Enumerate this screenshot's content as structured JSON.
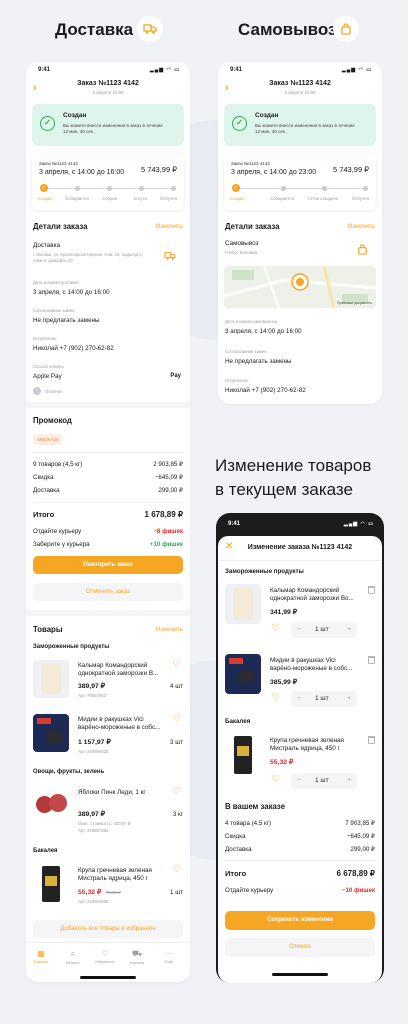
{
  "titles": {
    "delivery": "Доставка",
    "pickup": "Самовывоз",
    "edit_title": "Изменение товаров",
    "edit_title2": "в текущем заказе"
  },
  "colors": {
    "accent": "#f5a623",
    "green": "#2dae5a",
    "red": "#e02a2a",
    "status_bg": "#dff4ea"
  },
  "status_bar": {
    "time": "9:41"
  },
  "order_header": {
    "title": "Заказ №1123 4142",
    "date": "2 апреля 10:56"
  },
  "status": {
    "title": "Создан",
    "text": "Вы можете внести изменения в заказ в течение 13 мин. 30 сек."
  },
  "delivery": {
    "card": {
      "order": "Заказ №1123 4142",
      "when": "3 апреля, с 14:00 до 16:00",
      "sum": "5 743,99 ₽",
      "steps": [
        "Создан",
        "Собирается",
        "Собран",
        "В пути",
        "Получен"
      ]
    },
    "details": {
      "title": "Детали заказа",
      "edit": "Изменить",
      "type": "Доставка",
      "address": "г. Москва, ул. Краснопролетарская, 9 кв. 23, подъезд 2, этаж 3, домофон 23",
      "time_label": "Дата и время доставки",
      "time": "3 апреля, с 14:00 до 16:00",
      "repl_label": "Согласование замен",
      "repl": "Не предлагать замены",
      "recv_label": "Получатель",
      "recv": "Николай +7 (902) 270-62-82",
      "pay_label": "Способ оплаты",
      "pay": "Apple Pay",
      "pay_brand": "Pay",
      "paid": "Оплачен"
    },
    "promo": {
      "title": "Промокод",
      "code": "SKIDKA20"
    },
    "totals": {
      "goods": "9 товаров (4,5 кг)",
      "goods_v": "2 903,85 ₽",
      "disc": "Скидка",
      "disc_v": "−645,09 ₽",
      "deliv": "Доставка",
      "deliv_v": "299,00 ₽",
      "total": "Итого",
      "total_v": "1 678,89 ₽",
      "courier": "Отдайте курьеру",
      "courier_v": "−8 фишек",
      "take": "Заберите у курьера",
      "take_v": "+10 фишек"
    },
    "buttons": {
      "repeat": "Повторить заказ",
      "cancel": "Отменить заказ"
    },
    "goods": {
      "title": "Товары",
      "edit": "Изменить",
      "cat1": "Замороженные продукты",
      "cat2": "Овощи, фрукты, зелень",
      "cat3": "Бакалея",
      "items": [
        {
          "name": "Кальмар Командорский однократной заморозки В...",
          "price": "389,97 ₽",
          "art": "Арт. 76567863",
          "qty": "4 шт"
        },
        {
          "name": "Мидии в ракушках Vici варёно-мороженые в собс...",
          "price": "1 157,97 ₽",
          "art": "Арт. 234568433",
          "qty": "3 шт"
        },
        {
          "name": "Яблоки Пинк Леди, 1 кг",
          "price": "389,97 ₽",
          "art1": "Макс. стоимость: 400,97 ₽",
          "art": "Арт. 378657566",
          "qty": "3 кг"
        },
        {
          "name": "Крупа гречневая зеленая Мистраль ядрица, 450 г",
          "price": "55,32 ₽",
          "old": "75,00 ₽",
          "art": "Арт. 234563536",
          "qty": "1 шт"
        }
      ],
      "fav_all": "Добавить все товары в избранное"
    },
    "tabs": [
      "Главная",
      "Каталог",
      "Избранное",
      "Корзина",
      "Ещё"
    ]
  },
  "pickup": {
    "card": {
      "order": "Заказ №1123 4142",
      "when": "3 апреля, с 14:00 до 23:00",
      "sum": "5 743,99 ₽",
      "steps": [
        "Создан",
        "Собирается",
        "Готов к выдаче",
        "Получен"
      ]
    },
    "details": {
      "title": "Детали заказа",
      "edit": "Изменить",
      "type": "Самовывоз",
      "shop": "Глобус Коломна",
      "map_link": "Правовые документы",
      "time_label": "Дата и время самовывоза",
      "time": "3 апреля, с 14:00 до 16:00",
      "repl_label": "Согласование замен",
      "repl": "Не предлагать замены",
      "recv_label": "Получатель",
      "recv": "Николай +7 (902) 270-62-82"
    }
  },
  "edit": {
    "header": "Изменение заказа №1123 4142",
    "cat1": "Замороженные продукты",
    "cat2": "Бакалея",
    "items": [
      {
        "name": "Кальмар Командорский однократной заморозки Во...",
        "price": "341,99 ₽",
        "qty": "1 шт"
      },
      {
        "name": "Мидии в ракушках Vici варёно-мороженые в собс...",
        "price": "385,99 ₽",
        "qty": "1 шт"
      },
      {
        "name": "Крупа гречневая зеленая Мистраль ядрица, 450 г",
        "price": "55,32 ₽",
        "qty": "1 шт"
      }
    ],
    "summary": {
      "title": "В вашем заказе",
      "goods": "4 товара (4,5 кг)",
      "goods_v": "7 903,85 ₽",
      "disc": "Скидка",
      "disc_v": "−645,09 ₽",
      "deliv": "Доставка",
      "deliv_v": "299,00 ₽",
      "total": "Итого",
      "total_v": "6 678,89 ₽",
      "courier": "Отдайте курьеру",
      "courier_v": "−10 фишек"
    },
    "buttons": {
      "save": "Сохранить изменения",
      "cancel": "Отмена"
    }
  }
}
